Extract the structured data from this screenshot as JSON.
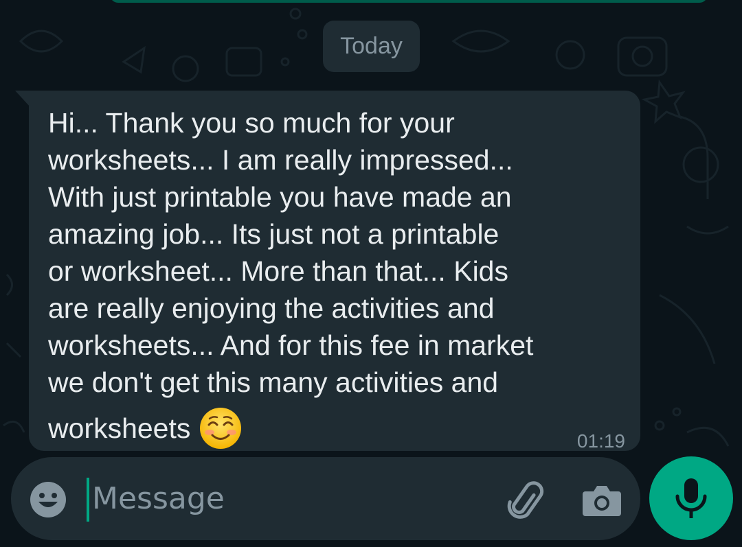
{
  "date_separator": "Today",
  "message": {
    "lines": [
      "Hi... Thank you so much for your",
      "worksheets... I am really impressed...",
      "With just printable you have made an",
      "amazing job... Its just not a printable",
      "or worksheet... More than that... Kids",
      "are really enjoying the activities and",
      "worksheets... And for this fee in market",
      "we don't get this many activities and"
    ],
    "last_line": "worksheets",
    "emoji": "smiling-face-with-smiling-eyes",
    "time": "01:19"
  },
  "composer": {
    "placeholder": "Message",
    "emoji_icon": "emoji-icon",
    "attach_icon": "paperclip-icon",
    "camera_icon": "camera-icon",
    "mic_icon": "microphone-icon"
  },
  "colors": {
    "background": "#0b141a",
    "bubble": "#1f2c33",
    "text": "#e9edef",
    "muted": "#8696a0",
    "accent": "#00a884"
  }
}
